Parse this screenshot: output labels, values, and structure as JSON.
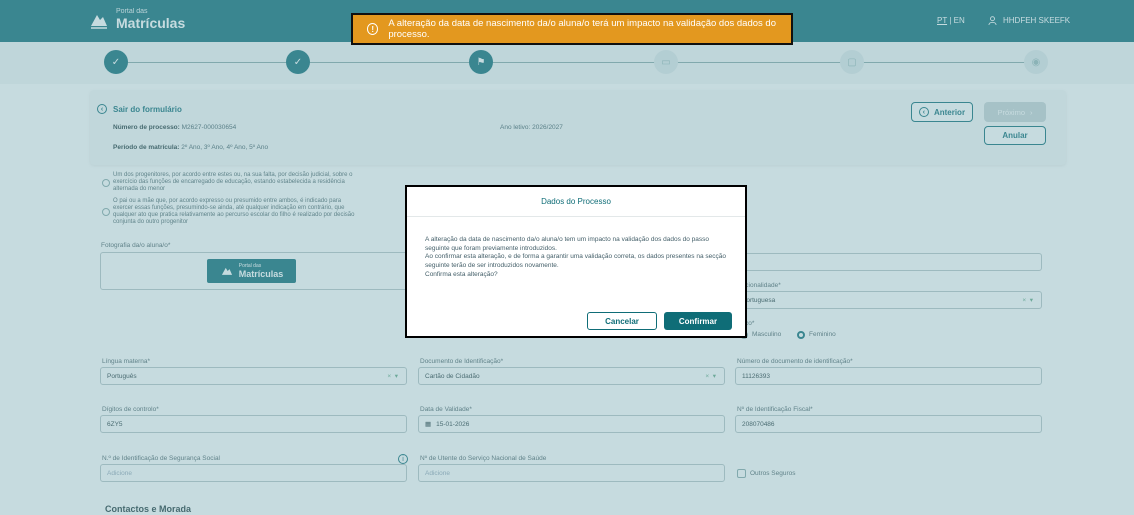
{
  "header": {
    "logo_small": "Portal das",
    "logo_big": "Matrículas",
    "lang_active": "PT",
    "lang_sep": "|",
    "lang_other": "EN",
    "user_name": "HHDFEH SKEEFK"
  },
  "toast": {
    "message": "A alteração da data de nascimento da/o aluna/o terá um impacto na validação dos dados do processo.",
    "icon": "alert-circle-icon",
    "color": "#e3981f"
  },
  "stepper": {
    "steps": [
      {
        "state": "done",
        "icon": "check-icon",
        "glyph": "✓"
      },
      {
        "state": "done",
        "icon": "check-icon",
        "glyph": "✓"
      },
      {
        "state": "current",
        "icon": "graduation-cap-icon",
        "glyph": "⚑"
      },
      {
        "state": "todo",
        "icon": "card-icon",
        "glyph": "▭"
      },
      {
        "state": "todo",
        "icon": "document-icon",
        "glyph": "▢"
      },
      {
        "state": "todo",
        "icon": "eye-icon",
        "glyph": "◉"
      }
    ]
  },
  "panel": {
    "exit_label": "Sair do formulário",
    "process_label": "Número de processo:",
    "process_value": "M2627-000030654",
    "year_label": "Ano letivo:",
    "year_value": "2026/2027",
    "period_label": "Período de matrícula:",
    "period_value": "2º Ano, 3º Ano, 4º Ano, 5º Ano",
    "prev_button": "Anterior",
    "next_button": "Próximo",
    "cancel_button": "Anular"
  },
  "form": {
    "radio_text_1": "Um dos progenitores, por acordo entre estes ou, na sua falta, por decisão judicial, sobre o exercício das funções de encarregado de educação, estando estabelecida a residência alternada do menor",
    "radio_text_2": "O pai ou a mãe que, por acordo expresso ou presumido entre ambos, é indicado para exercer essas funções, presumindo-se ainda, até qualquer indicação em contrário, que qualquer ato que pratica relativamente ao percurso escolar do filho é realizado por decisão conjunta do outro progenitor",
    "photo_label": "Fotografia da/o aluna/o*",
    "nationality_label": "Nacionalidade*",
    "nationality_value": "Portuguesa",
    "sex_label": "Sexo*",
    "sex_male": "Masculino",
    "sex_female": "Feminino",
    "mother_tongue_label": "Língua materna*",
    "mother_tongue_value": "Português",
    "id_doc_label": "Documento de Identificação*",
    "id_doc_value": "Cartão de Cidadão",
    "id_number_label": "Número de documento de identificação*",
    "id_number_value": "11126393",
    "check_digits_label": "Dígitos de controlo*",
    "check_digits_value": "6ZY5",
    "validity_label": "Data de Validade*",
    "validity_value": "15-01-2026",
    "nif_label": "Nº de Identificação Fiscal*",
    "nif_value": "208070486",
    "social_sec_label": "N.º de Identificação de Segurança Social",
    "social_sec_placeholder": "Adicione",
    "sns_label": "Nº de Utente do Serviço Nacional de Saúde",
    "sns_placeholder": "Adicione",
    "other_insurance_label": "Outros Seguros",
    "section_contacts": "Contactos e Morada",
    "clear_mark": "×",
    "dropdown_mark": "▾"
  },
  "modal": {
    "title": "Dados do Processo",
    "body_line1": "A alteração da data de nascimento da/o aluna/o tem um impacto na validação dos dados do passo seguinte que foram previamente introduzidos.",
    "body_line2": "Ao confirmar esta alteração, e de forma a garantir uma validação correta, os dados presentes na secção seguinte terão de ser introduzidos novamente.",
    "body_line3": "Confirma esta alteração?",
    "cancel": "Cancelar",
    "confirm": "Confirmar"
  }
}
